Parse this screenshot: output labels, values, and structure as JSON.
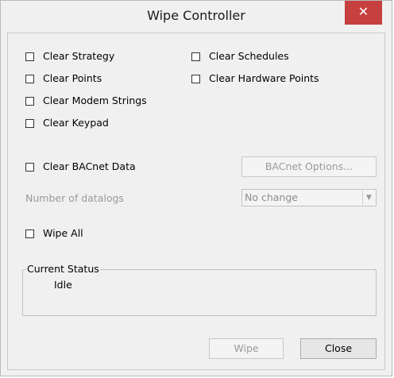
{
  "window": {
    "title": "Wipe Controller",
    "close_glyph": "✕"
  },
  "options": {
    "clear_strategy": "Clear Strategy",
    "clear_points": "Clear Points",
    "clear_modem_strings": "Clear Modem Strings",
    "clear_keypad": "Clear Keypad",
    "clear_schedules": "Clear Schedules",
    "clear_hardware_points": "Clear Hardware Points",
    "clear_bacnet_data": "Clear BACnet Data",
    "wipe_all": "Wipe All"
  },
  "bacnet": {
    "options_button": "BACnet Options..."
  },
  "datalogs": {
    "label": "Number of datalogs",
    "selected": "No change",
    "arrow": "▼"
  },
  "status": {
    "caption": "Current Status",
    "value": "Idle"
  },
  "buttons": {
    "wipe": "Wipe",
    "close": "Close"
  },
  "colors": {
    "close_button_bg": "#c74040",
    "dialog_bg": "#f0f0f0",
    "disabled_text": "#9a9a9a"
  }
}
